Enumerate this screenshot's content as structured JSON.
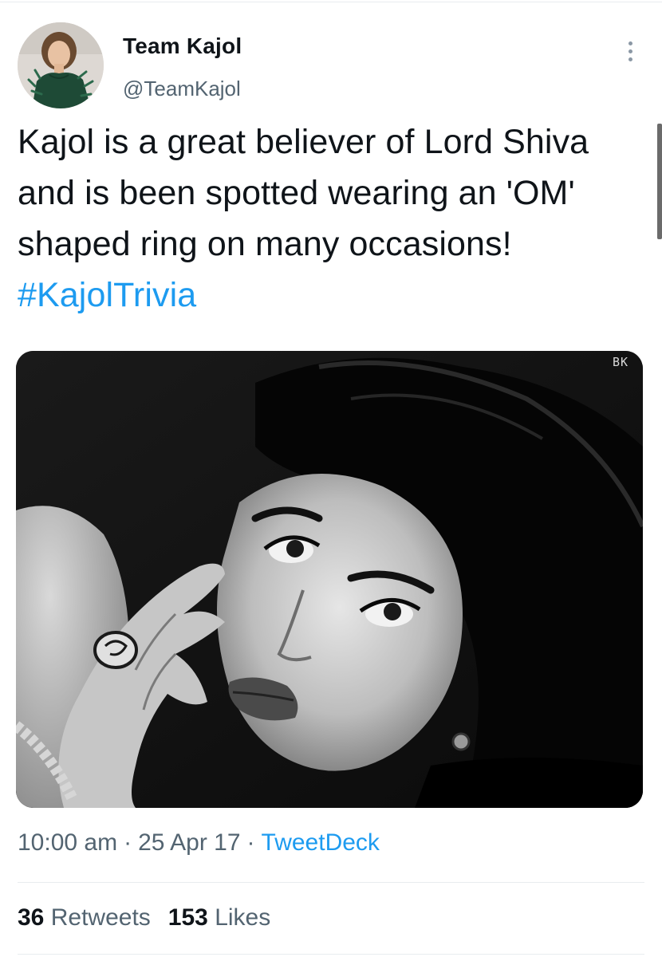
{
  "author": {
    "display_name": "Team Kajol",
    "handle": "@TeamKajol",
    "avatar_icon": "profile-avatar"
  },
  "more_icon": "more-vertical-icon",
  "tweet": {
    "text": "Kajol is a great believer of Lord Shiva and is been spotted wearing an 'OM' shaped ring on many occasions! ",
    "hashtag": "#KajolTrivia"
  },
  "media": {
    "watermark": "BK"
  },
  "meta": {
    "time": "10:00 am",
    "date": "25 Apr 17",
    "separator": "·",
    "source": "TweetDeck"
  },
  "stats": {
    "retweets_count": "36",
    "retweets_label": "Retweets",
    "likes_count": "153",
    "likes_label": "Likes"
  },
  "colors": {
    "accent": "#1d9bf0",
    "text_primary": "#0f1419",
    "text_secondary": "#536471",
    "divider": "#e8ecef"
  }
}
